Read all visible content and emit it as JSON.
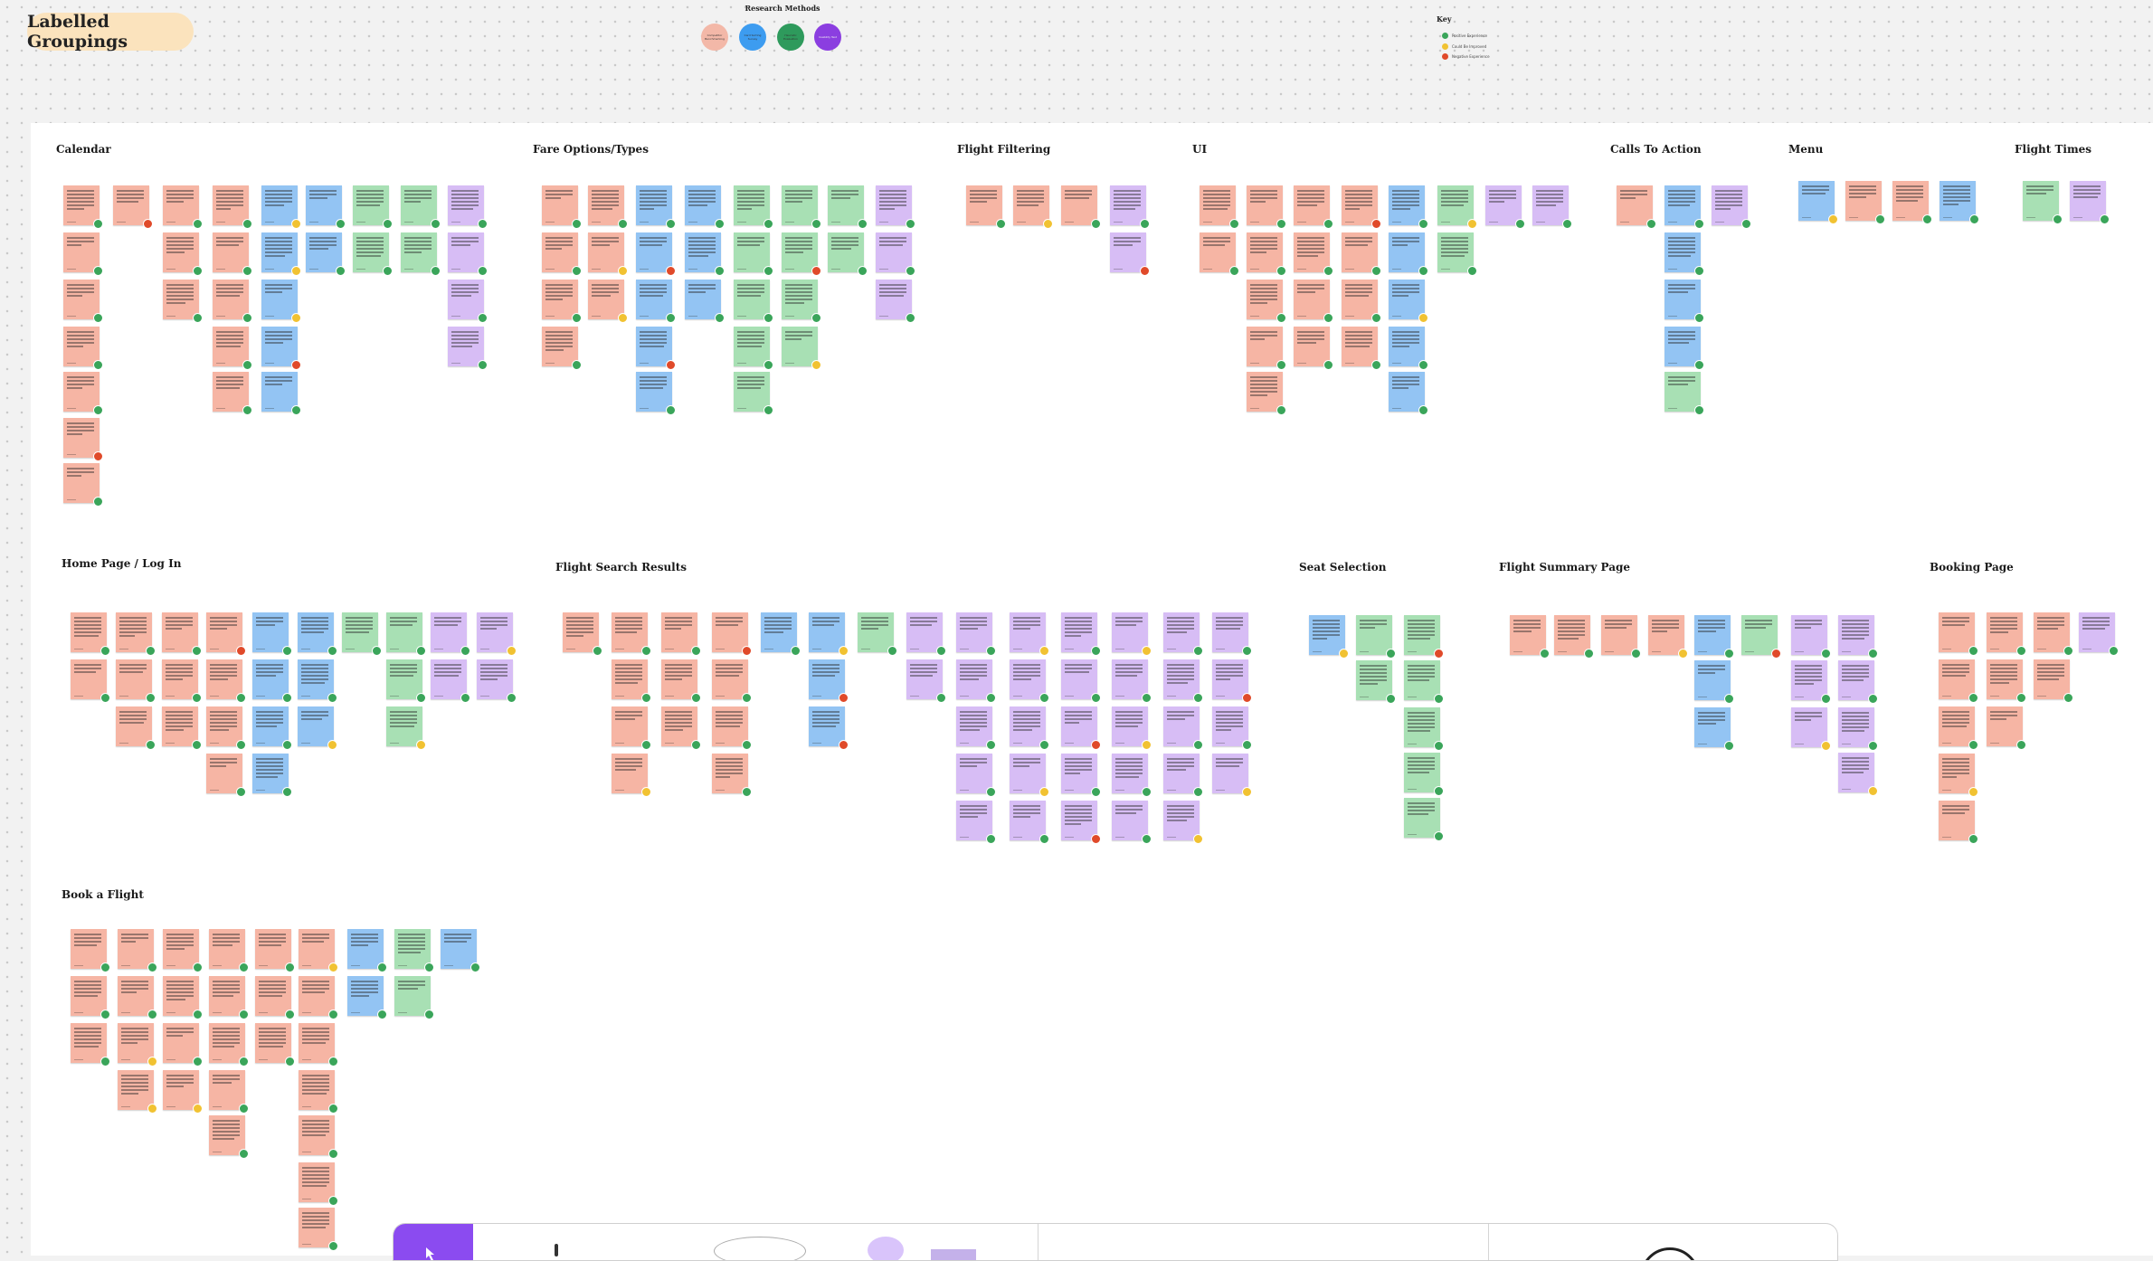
{
  "board": {
    "title": "Labelled Groupings"
  },
  "research_methods": {
    "title": "Research Methods",
    "items": [
      {
        "label": "Competitor Benchmarking",
        "color": "#f3b8a8"
      },
      {
        "label": "Card Sorting Survey",
        "color": "#3d9cf0"
      },
      {
        "label": "Heuristic Evaluation",
        "color": "#2e9a5c"
      },
      {
        "label": "Usability Test",
        "color": "#8b3ee0"
      }
    ]
  },
  "key": {
    "title": "Key",
    "items": [
      {
        "label": "Positive Experience",
        "color": "#3aa55a"
      },
      {
        "label": "Could Be Improved",
        "color": "#f1c232"
      },
      {
        "label": "Negative Experience",
        "color": "#e04a2a"
      }
    ]
  },
  "colors": {
    "salmon": "#f6b5a4",
    "blue": "#93c4f3",
    "green": "#a8e0b4",
    "purple": "#d7bdf5",
    "dot_green": "#3aa55a",
    "dot_yellow": "#f1c232",
    "dot_red": "#e04a2a",
    "board_bg": "#ffffff",
    "toolbar_accent": "#8b4bf0"
  },
  "sections": [
    {
      "name": "calendar",
      "title": "Calendar"
    },
    {
      "name": "fare-options",
      "title": "Fare Options/Types"
    },
    {
      "name": "flight-filtering",
      "title": "Flight Filtering"
    },
    {
      "name": "ui",
      "title": "UI"
    },
    {
      "name": "calls-to-action",
      "title": "Calls To Action"
    },
    {
      "name": "menu",
      "title": "Menu"
    },
    {
      "name": "flight-times",
      "title": "Flight Times"
    },
    {
      "name": "home-page-log-in",
      "title": "Home Page / Log In"
    },
    {
      "name": "flight-search-results",
      "title": "Flight Search Results"
    },
    {
      "name": "seat-selection",
      "title": "Seat Selection"
    },
    {
      "name": "flight-summary-page",
      "title": "Flight Summary Page"
    },
    {
      "name": "booking-page",
      "title": "Booking Page"
    },
    {
      "name": "book-a-flight",
      "title": "Book a Flight"
    }
  ],
  "toolbar": {
    "tools": [
      "select-tool",
      "pen-tool",
      "text-tool",
      "sticky-note-tool",
      "shape-tool",
      "stamp-tool"
    ]
  }
}
